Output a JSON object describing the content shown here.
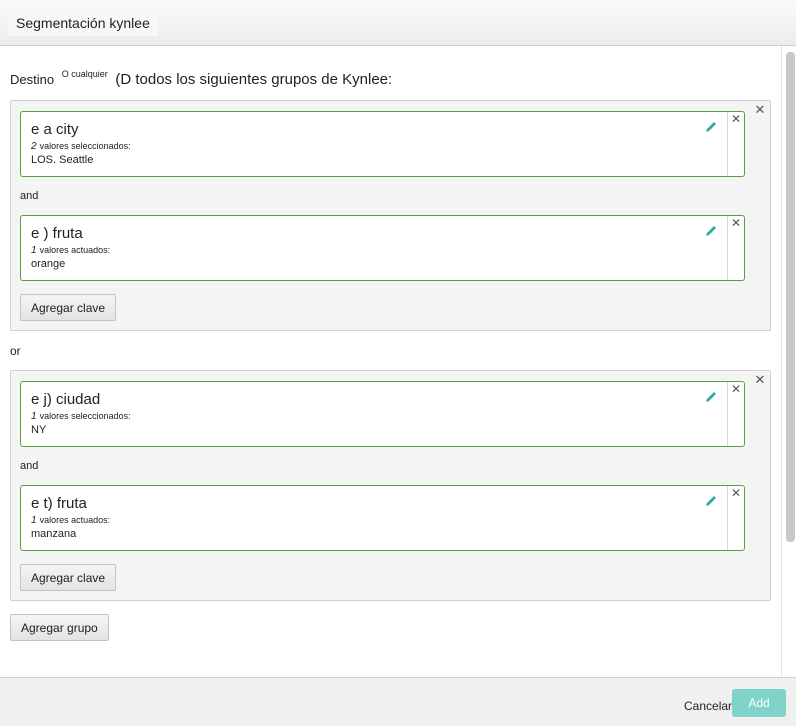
{
  "window": {
    "title": "Segmentación kynlee"
  },
  "destino": {
    "label": "Destino",
    "option": "O cualquier",
    "text": "(D todos los siguientes grupos de Kynlee:"
  },
  "groups": [
    {
      "keys": [
        {
          "name": "e a city",
          "count": "2",
          "count_label": "valores seleccionados:",
          "values": "LOS. Seattle"
        },
        {
          "name": "e ) fruta",
          "count": "1",
          "count_label": "valores actuados:",
          "values": "orange"
        }
      ],
      "and_label": "and",
      "add_key_label": "Agregar clave"
    },
    {
      "keys": [
        {
          "name": "e j) ciudad",
          "count": "1",
          "count_label": "valores seleccionados:",
          "values": "NY"
        },
        {
          "name": "e t) fruta",
          "count": "1",
          "count_label": "valores actuados:",
          "values": "manzana"
        }
      ],
      "and_label": "and",
      "add_key_label": "Agregar clave"
    }
  ],
  "or_label": "or",
  "add_group_label": "Agregar grupo",
  "footer": {
    "cancel_label": "Cancelar",
    "add_label": "Add"
  },
  "icons": {
    "edit": "pencil-icon",
    "close": "close-icon"
  },
  "colors": {
    "key_border": "#55a43b",
    "edit_icon": "#2fa9a0",
    "add_button": "#7fd3c8"
  }
}
